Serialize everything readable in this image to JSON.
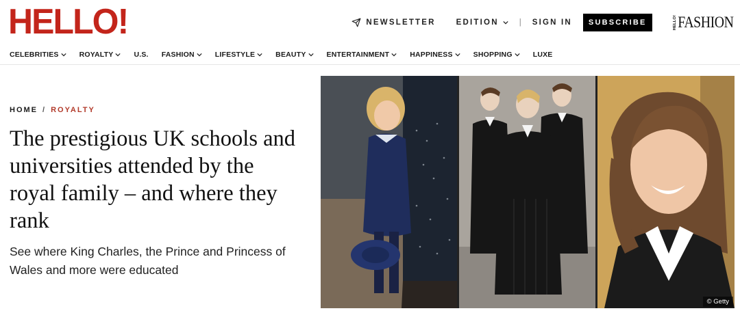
{
  "brand": {
    "logo_text": "HELLO!",
    "logo_color": "#c3251b",
    "fashion_mini": "HELLO!",
    "fashion_text": "FASHION"
  },
  "utility": {
    "newsletter": "NEWSLETTER",
    "edition": "EDITION",
    "separator": "|",
    "sign_in": "SIGN IN",
    "subscribe": "SUBSCRIBE"
  },
  "nav": {
    "items": [
      {
        "label": "CELEBRITIES",
        "dropdown": true
      },
      {
        "label": "ROYALTY",
        "dropdown": true
      },
      {
        "label": "U.S.",
        "dropdown": false
      },
      {
        "label": "FASHION",
        "dropdown": true
      },
      {
        "label": "LIFESTYLE",
        "dropdown": true
      },
      {
        "label": "BEAUTY",
        "dropdown": true
      },
      {
        "label": "ENTERTAINMENT",
        "dropdown": true
      },
      {
        "label": "HAPPINESS",
        "dropdown": true
      },
      {
        "label": "SHOPPING",
        "dropdown": true
      },
      {
        "label": "LUXE",
        "dropdown": false
      }
    ]
  },
  "breadcrumb": {
    "home": "HOME",
    "separator": "/",
    "section": "ROYALTY",
    "section_color": "#b23a2a"
  },
  "article": {
    "headline": "The prestigious UK schools and universities attended by the royal family – and where they rank",
    "standfirst": "See where King Charles, the Prince and Princess of Wales and more were educated"
  },
  "image": {
    "credit": "© Getty",
    "panels": [
      "child-in-navy-coat",
      "boys-in-school-tailcoats",
      "woman-smiling"
    ]
  }
}
